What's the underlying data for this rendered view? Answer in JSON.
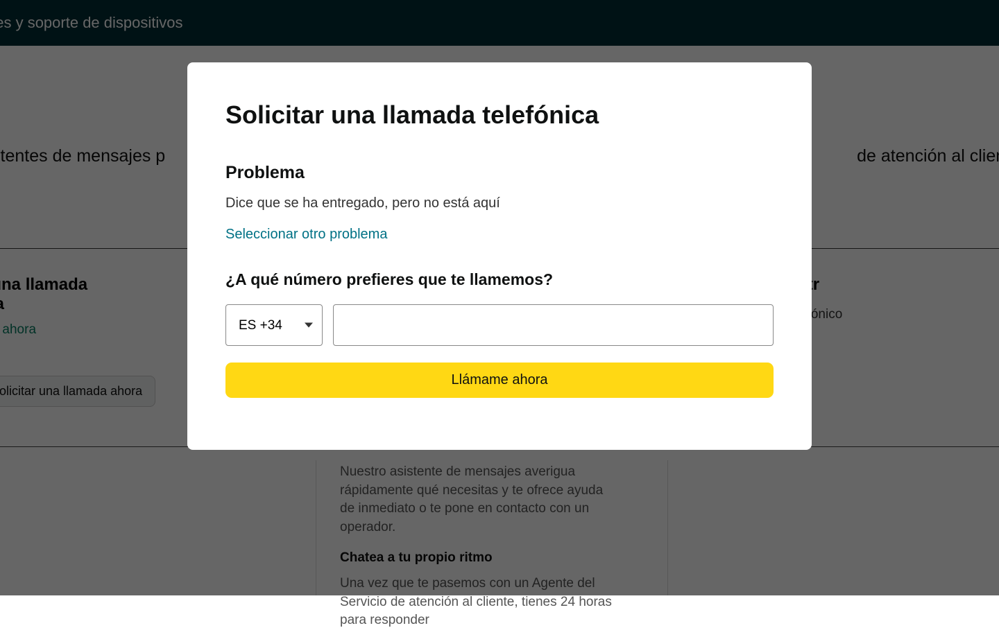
{
  "header": {
    "title": "tales y soporte de dispositivos"
  },
  "background": {
    "left_text": "sistentes de mensajes p",
    "right_text": "de atención al cliente",
    "col1": {
      "title_l1": "ar una llamada",
      "title_l2": "nica",
      "avail": "nible ahora",
      "button": "Solicitar una llamada ahora"
    },
    "col3": {
      "title": "os un correo electr",
      "sub": "nvíanos un correo electrónico"
    },
    "mid": {
      "p1": "Nuestro asistente de mensajes averigua rápidamente qué necesitas y te ofrece ayuda de inmediato o te pone en contacto con un operador.",
      "bold": "Chatea a tu propio ritmo",
      "p2": "Una vez que te pasemos con un Agente del Servicio de atención al cliente, tienes 24 horas para responder"
    }
  },
  "modal": {
    "title": "Solicitar una llamada telefónica",
    "issue_label": "Problema",
    "issue_text": "Dice que se ha entregado, pero no está aquí",
    "change_link": "Seleccionar otro problema",
    "phone_question": "¿A qué número prefieres que te llamemos?",
    "country_code": "ES +34",
    "phone_value": "",
    "call_button": "Llámame ahora"
  }
}
